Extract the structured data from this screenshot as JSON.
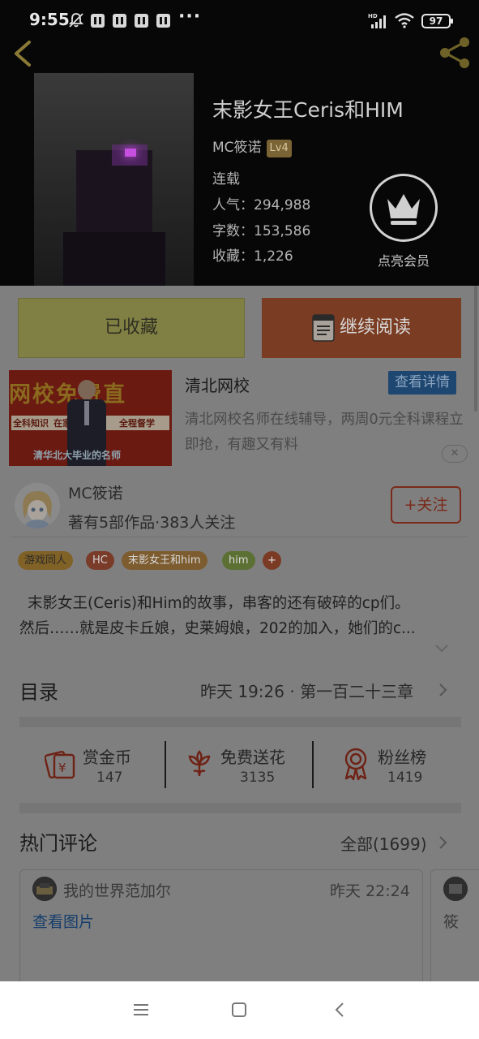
{
  "status_bar": {
    "time": "9:55",
    "dots": "···",
    "battery": "97",
    "icons": [
      "mute-bell-icon",
      "pause-icon",
      "pause-icon",
      "pause-icon",
      "pause-icon",
      "hd-signal-icon",
      "wifi-icon",
      "battery-icon"
    ]
  },
  "book": {
    "title": "末影女王Ceris和HIM",
    "author": "MC筱诺",
    "author_level": "Lv4",
    "status": "连载",
    "popularity": "人气：294,988",
    "word_count": "字数：153,586",
    "favorites": "收藏：1,226",
    "vip_label": "点亮会员"
  },
  "actions": {
    "collected_label": "已收藏",
    "continue_label": "继续阅读"
  },
  "ad": {
    "banner_text": "网校免费直",
    "banner_sub1": "全科知识",
    "banner_sub2": "在家",
    "banner_sub3": "全程督学",
    "banner_bottom": "清华北大毕业的名师",
    "title": "清北网校",
    "button": "查看详情",
    "description": "清北网校名师在线辅导，两周0元全科课程立即抢，有趣又有料",
    "close": "✕"
  },
  "author_card": {
    "name": "MC筱诺",
    "meta": "著有5部作品·383人关注",
    "follow_label": "+关注"
  },
  "tags": [
    "游戏同人",
    "HC",
    "末影女王和him",
    "him",
    "+"
  ],
  "intro": {
    "line1": "末影女王(Ceris)和Him的故事，串客的还有破碎的cp们。",
    "line2": "然后……就是皮卡丘娘，史莱姆娘，202的加入，她们的c..."
  },
  "toc": {
    "title": "目录",
    "latest": "昨天 19:26 · 第一百二十三章"
  },
  "gifts": [
    {
      "label": "赏金币",
      "count": "147",
      "icon": "reward-coin-icon"
    },
    {
      "label": "免费送花",
      "count": "3135",
      "icon": "flower-icon"
    },
    {
      "label": "粉丝榜",
      "count": "1419",
      "icon": "medal-icon"
    }
  ],
  "comments": {
    "title": "热门评论",
    "all": "全部(1699)",
    "items": [
      {
        "user": "我的世界范加尔",
        "time": "昨天 22:24",
        "content": "查看图片"
      },
      {
        "user": "",
        "time": "",
        "content": "筱"
      }
    ]
  },
  "colors": {
    "header_bg": "#070707",
    "dim_overlay": "#7f7f7f",
    "collect_btn": "#808045",
    "read_btn": "#7a3c22",
    "accent_red": "#7a2a1a",
    "link_blue": "#153d6c"
  }
}
